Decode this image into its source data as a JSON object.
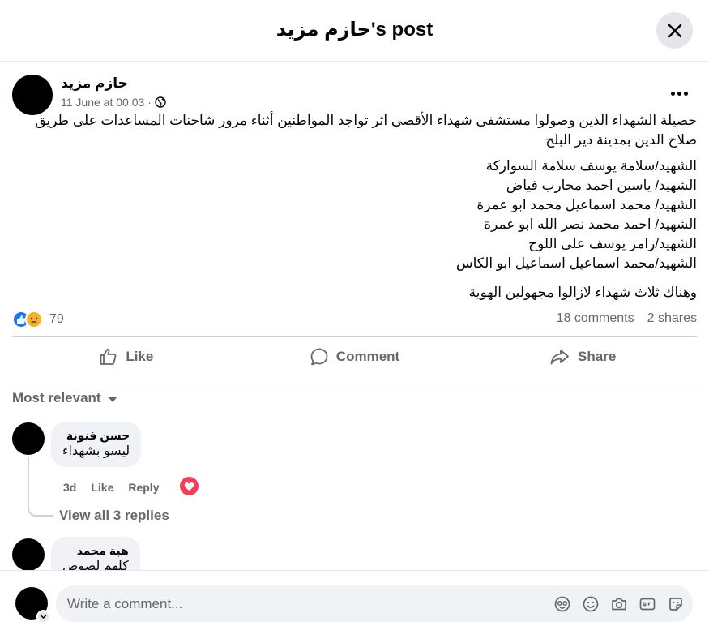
{
  "header": {
    "title": "حازم مزيد's post"
  },
  "post": {
    "author": "حازم مزيد",
    "date": "11 June at 00:03",
    "separator": "·",
    "intro": "حصيلة الشهداء الذين وصولوا مستشفى شهداء الأقصى اثر تواجد المواطنين أثناء مرور شاحنات المساعدات على طريق صلاح الدين بمدينة دير البلح",
    "names": [
      "الشهيد/سلامة يوسف سلامة السواركة",
      "الشهيد/ ياسين احمد محارب فياض",
      "الشهيد/ محمد اسماعيل محمد ابو عمرة",
      "الشهيد/ احمد محمد نصر الله ابو عمرة",
      "الشهيد/رامز يوسف على اللوح",
      "الشهيد/محمد اسماعيل اسماعيل ابو الكاس"
    ],
    "closing": "وهناك ثلاث شهداء لازالوا مجهولين الهوية",
    "reaction_count": "79",
    "comments_count": "18 comments",
    "shares_count": "2 shares"
  },
  "actions": {
    "like": "Like",
    "comment": "Comment",
    "share": "Share"
  },
  "comments": {
    "sort_label": "Most relevant",
    "items": [
      {
        "name": "حسن فنونة",
        "text": "ليسو بشهداء",
        "time": "3d",
        "like": "Like",
        "reply": "Reply",
        "view_replies": "View all 3 replies"
      },
      {
        "name": "هبة محمد",
        "text": "كلهم لصوص"
      }
    ]
  },
  "composer": {
    "placeholder": "Write a comment..."
  },
  "colors": {
    "accent": "#1877f2",
    "love": "#f33e58",
    "secondary_text": "#65676b"
  }
}
